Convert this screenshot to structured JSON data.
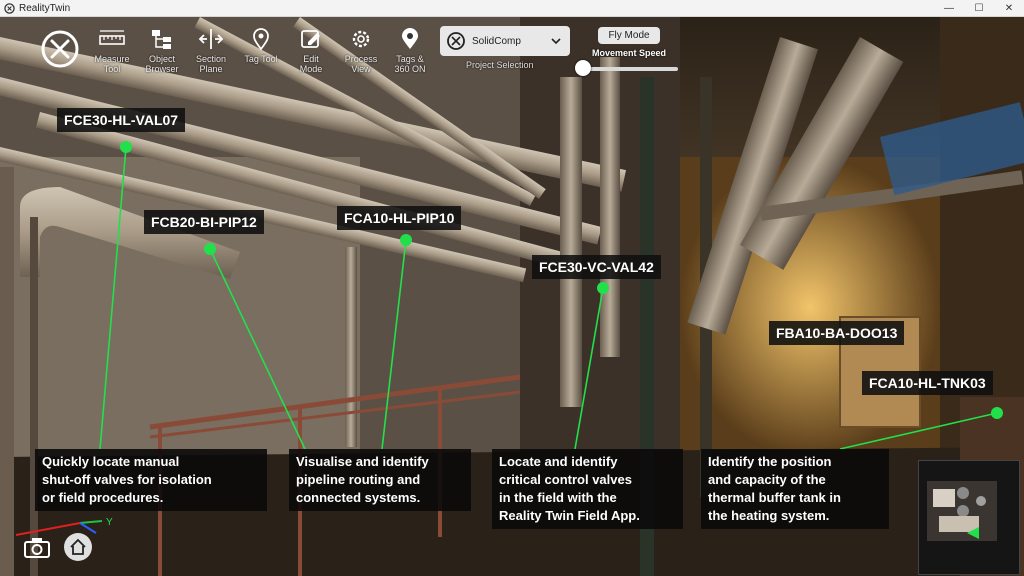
{
  "window": {
    "title": "RealityTwin",
    "minimize": "—",
    "maximize": "☐",
    "close": "✕"
  },
  "toolbar": {
    "tools": [
      {
        "name": "measure",
        "label_1": "Measure",
        "label_2": "Tool"
      },
      {
        "name": "object-browser",
        "label_1": "Object",
        "label_2": "Browser"
      },
      {
        "name": "section-plane",
        "label_1": "Section",
        "label_2": "Plane"
      },
      {
        "name": "tag-tool",
        "label_1": "Tag Tool",
        "label_2": ""
      },
      {
        "name": "edit-mode",
        "label_1": "Edit",
        "label_2": "Mode"
      },
      {
        "name": "process-view",
        "label_1": "Process",
        "label_2": "View"
      },
      {
        "name": "tags-360",
        "label_1": "Tags &",
        "label_2": "360 ON"
      }
    ],
    "project_value": "SolidComp",
    "project_label": "Project Selection",
    "fly_mode": "Fly Mode",
    "movement_speed_label": "Movement Speed",
    "movement_speed": 0.05
  },
  "tags": {
    "val07": "FCE30-HL-VAL07",
    "pip12": "FCB20-BI-PIP12",
    "pip10": "FCA10-HL-PIP10",
    "val42": "FCE30-VC-VAL42",
    "doo13": "FBA10-BA-DOO13",
    "tnk03": "FCA10-HL-TNK03"
  },
  "info": {
    "box1": [
      "Quickly locate manual",
      "shut-off valves for isolation",
      "or field procedures."
    ],
    "box2": [
      "Visualise and identify",
      "pipeline routing and",
      "connected systems."
    ],
    "box3": [
      "Locate and identify",
      "critical control valves",
      "in the field with the",
      "Reality Twin Field App."
    ],
    "box4": [
      "Identify the position",
      "and capacity of the",
      "thermal buffer tank in",
      "the heating system."
    ]
  },
  "axis_label": "Y",
  "colors": {
    "accent_green": "#22e04a",
    "tag_bg": "#0f0f0f"
  }
}
